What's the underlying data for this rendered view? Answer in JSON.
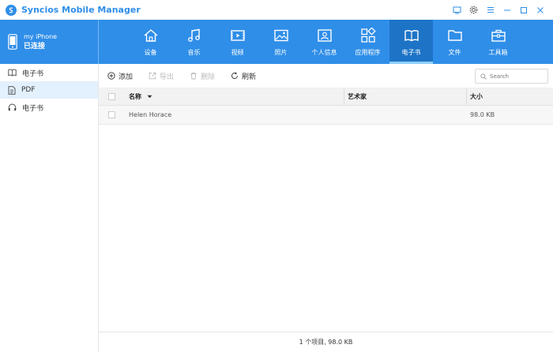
{
  "app": {
    "title": "Syncios Mobile Manager"
  },
  "device": {
    "name": "my iPhone",
    "status": "已连接"
  },
  "nav": [
    {
      "label": "设备",
      "icon": "home-icon",
      "active": false
    },
    {
      "label": "音乐",
      "icon": "music-icon",
      "active": false
    },
    {
      "label": "视频",
      "icon": "video-icon",
      "active": false
    },
    {
      "label": "照片",
      "icon": "photo-icon",
      "active": false
    },
    {
      "label": "个人信息",
      "icon": "contact-icon",
      "active": false
    },
    {
      "label": "应用程序",
      "icon": "apps-icon",
      "active": false
    },
    {
      "label": "电子书",
      "icon": "book-icon",
      "active": true
    },
    {
      "label": "文件",
      "icon": "folder-icon",
      "active": false
    },
    {
      "label": "工具箱",
      "icon": "toolbox-icon",
      "active": false
    }
  ],
  "sidebar": {
    "items": [
      {
        "label": "电子书",
        "icon": "book-icon",
        "active": false
      },
      {
        "label": "PDF",
        "icon": "document-icon",
        "active": true
      },
      {
        "label": "电子书",
        "icon": "headphones-icon",
        "active": false
      }
    ]
  },
  "toolbar": {
    "add_label": "添加",
    "export_label": "导出",
    "delete_label": "删除",
    "refresh_label": "刷新",
    "search_placeholder": "Search"
  },
  "table": {
    "columns": {
      "name": "名称",
      "artist": "艺术家",
      "size": "大小"
    },
    "rows": [
      {
        "name": "Helen Horace",
        "artist": "",
        "size": "98.0 KB"
      }
    ]
  },
  "status": {
    "text": "1 个项目, 98.0 KB"
  },
  "colors": {
    "accent": "#2f8ee8",
    "active_nav": "#1d74c7",
    "selected_row": "#e3f0fd"
  }
}
